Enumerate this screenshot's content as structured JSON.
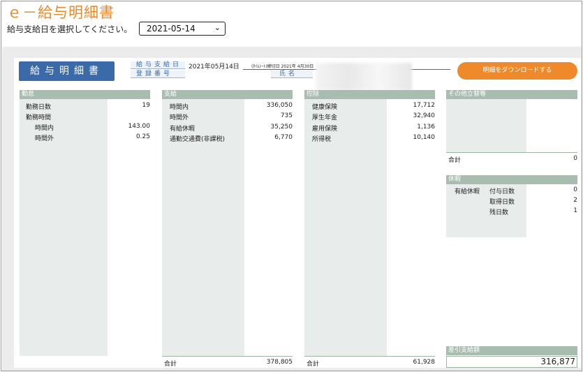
{
  "page": {
    "title": "ｅ－給与明細書",
    "prompt": "給与支給日を選択してください。",
    "pay_date_selected": "2021-05-14"
  },
  "slip": {
    "logo_label": "給与明細書",
    "pay_date_label": "給与支給日",
    "pay_date_value": "2021年05月14日",
    "cutoff_text": "(ﾀｲﾑｼｰﾄ)締切日 2021年 4月30日",
    "reg_no_label": "登録番号",
    "name_label": "氏名",
    "download_button": "明細をダウンロードする"
  },
  "attendance": {
    "header": "勤怠",
    "rows": [
      {
        "label": "勤務日数",
        "value": "19"
      },
      {
        "label": "勤務時間",
        "value": ""
      },
      {
        "label": "時間内",
        "value": "143.00"
      },
      {
        "label": "時間外",
        "value": "0.25"
      }
    ]
  },
  "payments": {
    "header": "支給",
    "rows": [
      {
        "label": "時間内",
        "value": "336,050"
      },
      {
        "label": "時間外",
        "value": "735"
      },
      {
        "label": "有給休暇",
        "value": "35,250"
      },
      {
        "label": "通勤交通費(非課税)",
        "value": "6,770"
      }
    ],
    "total_label": "合計",
    "total_value": "378,805"
  },
  "deductions": {
    "header": "控除",
    "rows": [
      {
        "label": "健康保険",
        "value": "17,712"
      },
      {
        "label": "厚生年金",
        "value": "32,940"
      },
      {
        "label": "雇用保険",
        "value": "1,136"
      },
      {
        "label": "所得税",
        "value": "10,140"
      }
    ],
    "total_label": "合計",
    "total_value": "61,928"
  },
  "other": {
    "header": "その他立替等",
    "total_label": "合計",
    "total_value": "0"
  },
  "leave": {
    "header": "休暇",
    "type_label": "有給休暇",
    "rows": [
      {
        "label": "付与日数",
        "value": "0"
      },
      {
        "label": "取得日数",
        "value": "2"
      },
      {
        "label": "残日数",
        "value": "1"
      }
    ]
  },
  "net": {
    "header": "差引支給額",
    "value": "316,877"
  },
  "colors": {
    "title": "#e88a2c",
    "logo_bg": "#3a6aa8",
    "download_bg": "#ef8a2b",
    "column_header": "#a9bcb0",
    "column_body": "#e8ecea"
  }
}
